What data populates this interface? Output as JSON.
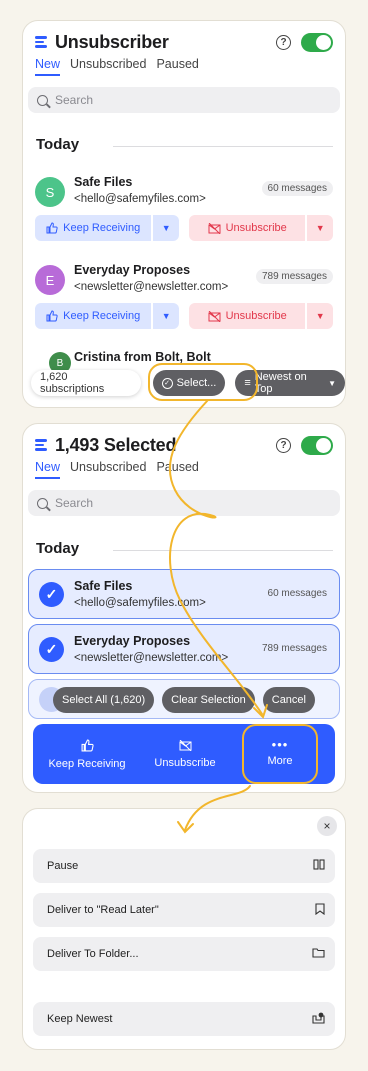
{
  "panel1": {
    "title": "Unsubscriber",
    "help_glyph": "?",
    "tabs": [
      "New",
      "Unsubscribed",
      "Paused"
    ],
    "search_placeholder": "Search",
    "section": "Today",
    "senders": [
      {
        "initial": "S",
        "color": "#4cc48a",
        "name": "Safe Files",
        "email": "<hello@safemyfiles.com>",
        "count": "60 messages"
      },
      {
        "initial": "E",
        "color": "#b86bd8",
        "name": "Everyday Proposes",
        "email": "<newsletter@newsletter.com>",
        "count": "789 messages"
      },
      {
        "initial": "B",
        "color": "#3f8d4b",
        "name": "Cristina from Bolt, Bolt",
        "email": "",
        "count": ""
      }
    ],
    "keep_label": "Keep Receiving",
    "unsub_label": "Unsubscribe",
    "subscriptions_label": "1,620 subscriptions",
    "select_label": "Select...",
    "sort_label": "Newest on Top"
  },
  "panel2": {
    "title": "1,493 Selected",
    "help_glyph": "?",
    "tabs": [
      "New",
      "Unsubscribed",
      "Paused"
    ],
    "search_placeholder": "Search",
    "section": "Today",
    "selected": [
      {
        "name": "Safe Files",
        "email": "<hello@safemyfiles.com>",
        "count": "60 messages"
      },
      {
        "name": "Everyday Proposes",
        "email": "<newsletter@newsletter.com>",
        "count": "789 messages"
      }
    ],
    "select_all_label": "Select All (1,620)",
    "clear_label": "Clear Selection",
    "cancel_label": "Cancel",
    "actions": [
      "Keep Receiving",
      "Unsubscribe",
      "More"
    ]
  },
  "panel3": {
    "close_glyph": "×",
    "items": [
      "Pause",
      "Deliver to \"Read Later\"",
      "Deliver To Folder...",
      "Keep Newest"
    ]
  },
  "colors": {
    "accent": "#2f5cff",
    "danger": "#e2384b",
    "toggle_on": "#2eaa4a",
    "highlight": "#f2b62c"
  }
}
